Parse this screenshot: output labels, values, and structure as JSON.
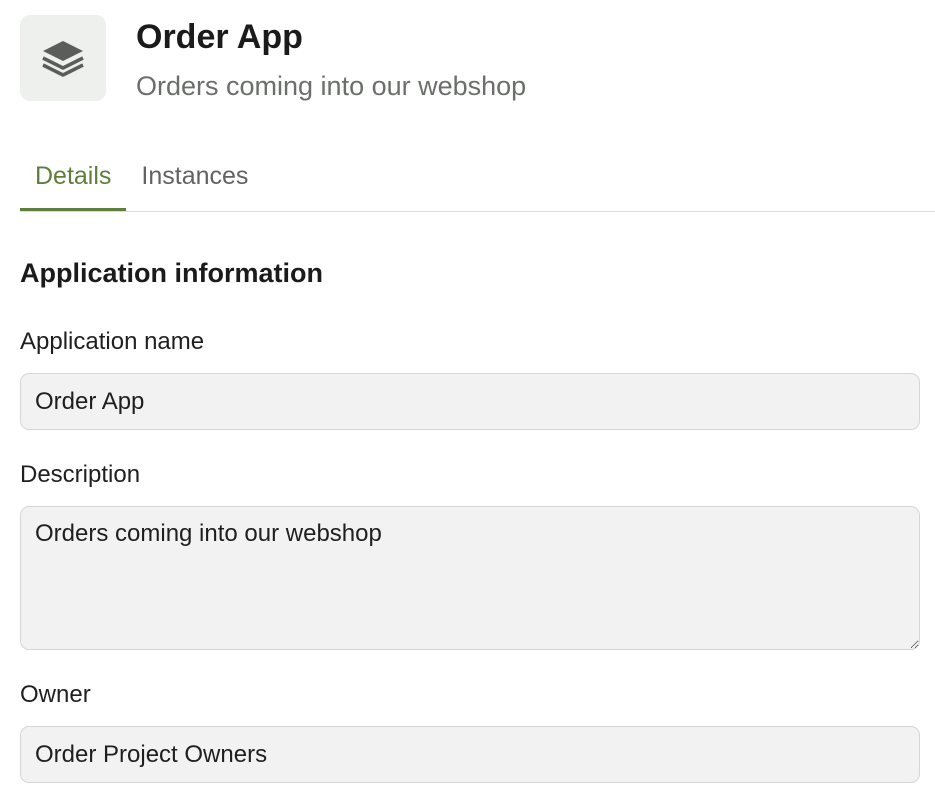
{
  "header": {
    "icon": "layers-icon",
    "title": "Order App",
    "subtitle": "Orders coming into our webshop"
  },
  "tabs": [
    {
      "label": "Details",
      "active": true
    },
    {
      "label": "Instances",
      "active": false
    }
  ],
  "section": {
    "title": "Application information"
  },
  "form": {
    "name_label": "Application name",
    "name_value": "Order App",
    "description_label": "Description",
    "description_value": "Orders coming into our webshop",
    "owner_label": "Owner",
    "owner_value": "Order Project Owners"
  },
  "colors": {
    "accent": "#5e7f3b",
    "field_background": "#f2f2f2",
    "icon_background": "#eef0ed"
  }
}
